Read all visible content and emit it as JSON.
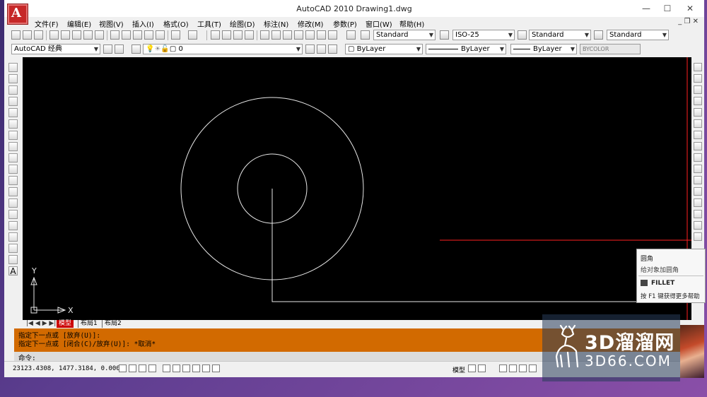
{
  "window": {
    "title": "AutoCAD 2010     Drawing1.dwg",
    "app_logo": "A",
    "controls": {
      "minimize": "—",
      "maximize": "☐",
      "close": "✕"
    }
  },
  "menu": {
    "items": [
      "文件(F)",
      "编辑(E)",
      "视图(V)",
      "插入(I)",
      "格式(O)",
      "工具(T)",
      "绘图(D)",
      "标注(N)",
      "修改(M)",
      "参数(P)",
      "窗口(W)",
      "帮助(H)"
    ],
    "doc_controls": "_ ❐ ✕"
  },
  "styles_toolbar": {
    "text_style": "Standard",
    "dim_style": "ISO-25",
    "table_style": "Standard",
    "multileader_style": "Standard"
  },
  "layers_toolbar": {
    "workspace": "AutoCAD 经典",
    "layer": "0",
    "color": "ByLayer",
    "linetype": "ByLayer",
    "lineweight": "ByLayer",
    "plotstyle": "BYCOLOR"
  },
  "ucs": {
    "x_label": "X",
    "y_label": "Y"
  },
  "tabs": {
    "model": "模型",
    "layout1": "布局1",
    "layout2": "布局2"
  },
  "command": {
    "line1": "指定下一点或 [放弃(U)]:",
    "line2": "指定下一点或 [闭合(C)/放弃(U)]: *取消*",
    "prompt": "命令:"
  },
  "status": {
    "coords": "23123.4308, 1477.3184, 0.0000",
    "model_label": "模型"
  },
  "tooltip": {
    "title": "圆角",
    "desc": "给对象加圆角",
    "command": "FILLET",
    "help": "按 F1 键获得更多帮助"
  },
  "watermark": {
    "big": "3D溜溜网",
    "small": "3D66.COM"
  },
  "colors": {
    "command_bg": "#d26a00",
    "canvas": "#000000",
    "tab_active": "#cc0000",
    "crosshair_red": "#ff2020"
  }
}
